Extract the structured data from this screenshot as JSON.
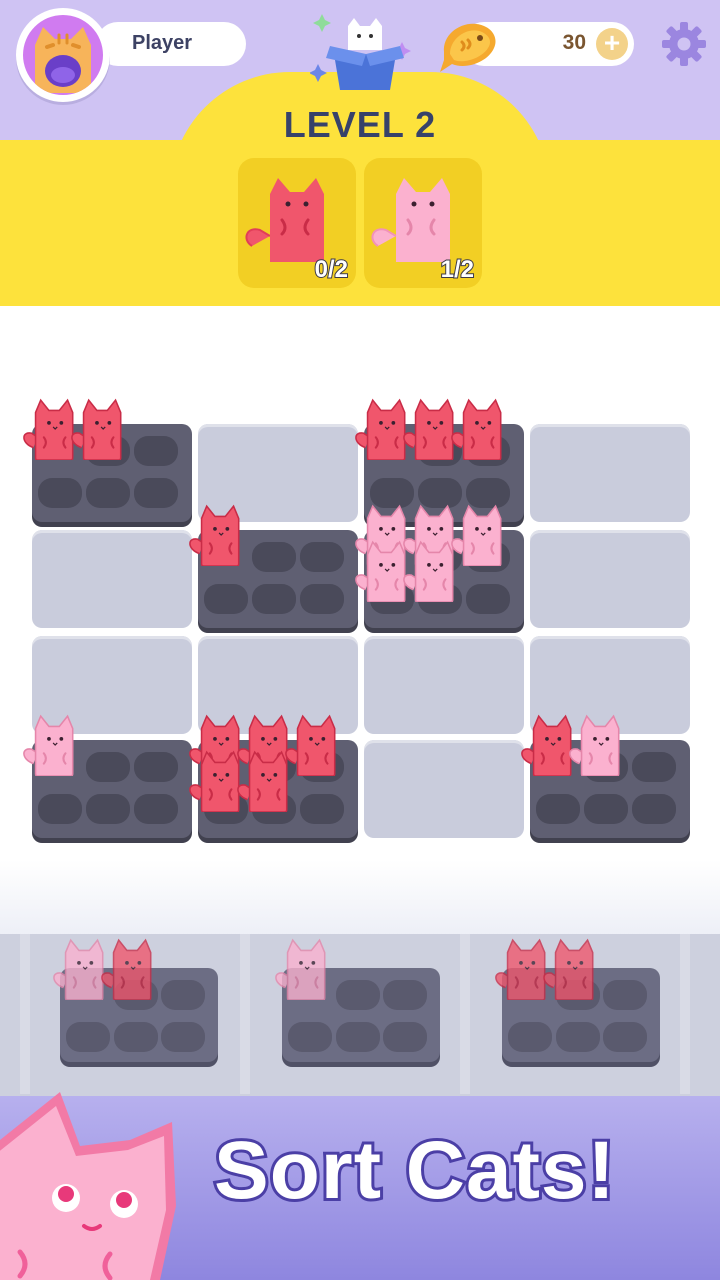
{
  "header": {
    "player_name": "Player",
    "coins": "30",
    "coin_plus": "+",
    "level_title": "LEVEL 2"
  },
  "goals": [
    {
      "cat_color": "red",
      "count": "0/2"
    },
    {
      "cat_color": "pink",
      "count": "1/2"
    }
  ],
  "colors": {
    "red_cat": "#f0566c",
    "pink_cat": "#fbb1cf",
    "header_purple": "#cfc3f3",
    "header_yellow": "#fde23c",
    "tray_dark": "#5f5f72",
    "empty_tile": "#c9ccdc"
  },
  "board": {
    "grid": "4x4",
    "tiles": [
      {
        "row": 0,
        "col": 0,
        "kind": "tray",
        "cats": [
          "red",
          "red"
        ]
      },
      {
        "row": 0,
        "col": 1,
        "kind": "empty",
        "cats": []
      },
      {
        "row": 0,
        "col": 2,
        "kind": "tray",
        "cats": [
          "red",
          "red",
          "red"
        ]
      },
      {
        "row": 0,
        "col": 3,
        "kind": "empty",
        "cats": []
      },
      {
        "row": 1,
        "col": 0,
        "kind": "empty",
        "cats": []
      },
      {
        "row": 1,
        "col": 1,
        "kind": "tray",
        "cats": [
          "red"
        ]
      },
      {
        "row": 1,
        "col": 2,
        "kind": "tray",
        "cats": [
          "pink",
          "pink",
          "pink",
          "pink",
          "pink"
        ]
      },
      {
        "row": 1,
        "col": 3,
        "kind": "empty",
        "cats": []
      },
      {
        "row": 2,
        "col": 0,
        "kind": "empty",
        "cats": []
      },
      {
        "row": 2,
        "col": 1,
        "kind": "empty",
        "cats": []
      },
      {
        "row": 2,
        "col": 2,
        "kind": "empty",
        "cats": []
      },
      {
        "row": 2,
        "col": 3,
        "kind": "empty",
        "cats": []
      },
      {
        "row": 3,
        "col": 0,
        "kind": "tray",
        "cats": [
          "pink"
        ]
      },
      {
        "row": 3,
        "col": 1,
        "kind": "tray",
        "cats": [
          "red",
          "red",
          "red",
          "red",
          "red"
        ]
      },
      {
        "row": 3,
        "col": 2,
        "kind": "empty",
        "cats": []
      },
      {
        "row": 3,
        "col": 3,
        "kind": "tray",
        "cats": [
          "red",
          "pink"
        ]
      }
    ]
  },
  "queue": [
    {
      "cats": [
        "pink",
        "red"
      ]
    },
    {
      "cats": [
        "pink"
      ]
    },
    {
      "cats": [
        "red",
        "red"
      ]
    }
  ],
  "banner": {
    "tagline": "Sort Cats!"
  },
  "icons": [
    "avatar-cat-icon",
    "cat-box-icon",
    "fish-coin-icon",
    "plus-icon",
    "gear-icon"
  ]
}
